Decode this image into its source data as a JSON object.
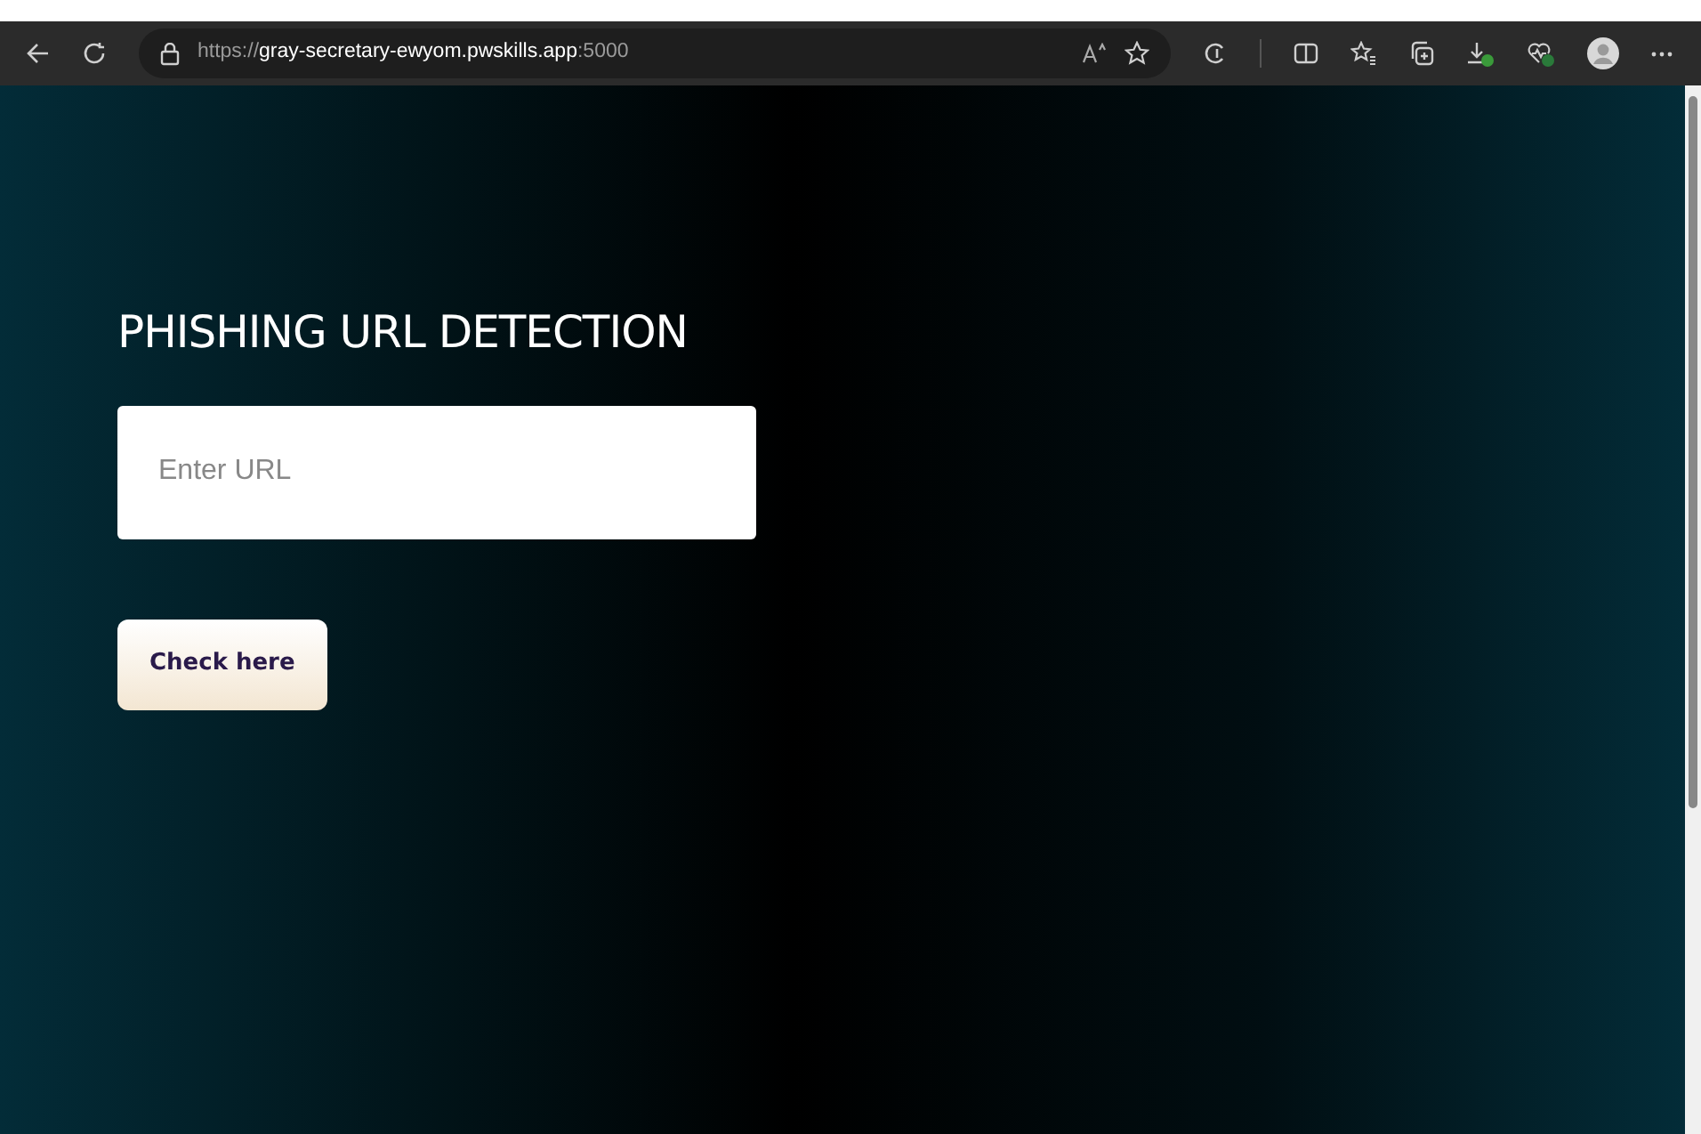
{
  "browser": {
    "url_scheme": "https://",
    "url_host": "gray-secretary-ewyom.pwskills.app",
    "url_port": ":5000"
  },
  "page": {
    "title": "PHISHING URL DETECTION",
    "url_field": {
      "placeholder": "Enter URL"
    },
    "check_button": "Check here"
  }
}
